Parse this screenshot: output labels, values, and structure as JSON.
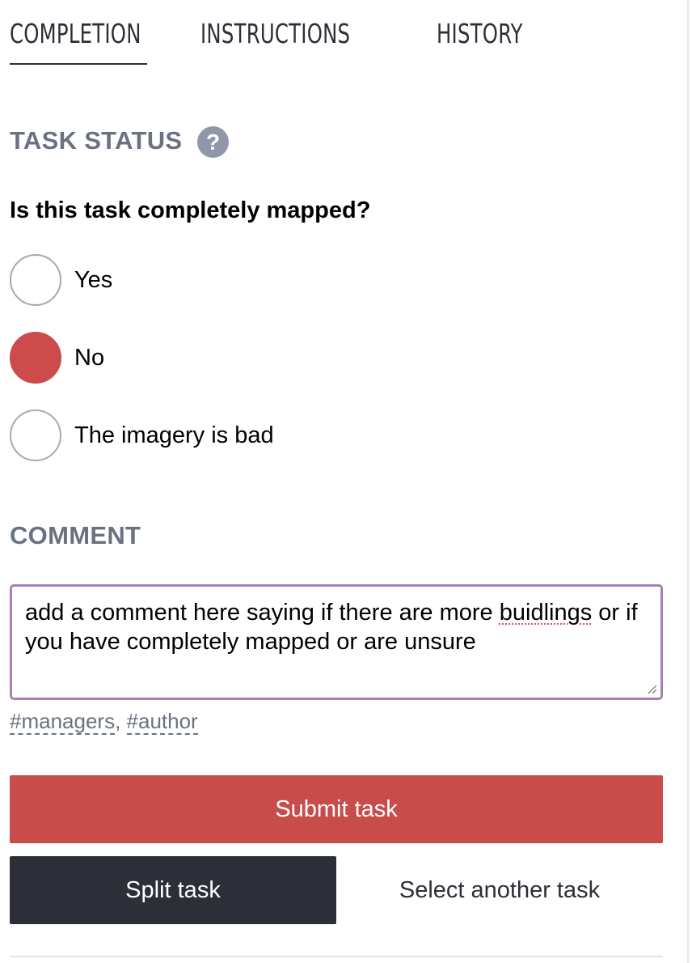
{
  "tabs": [
    {
      "label": "COMPLETION",
      "active": true
    },
    {
      "label": "INSTRUCTIONS",
      "active": false
    },
    {
      "label": "HISTORY",
      "active": false
    }
  ],
  "task_status": {
    "title": "TASK STATUS",
    "help_icon": "question-circle-icon",
    "question": "Is this task completely mapped?",
    "options": [
      {
        "label": "Yes",
        "selected": false
      },
      {
        "label": "No",
        "selected": true
      },
      {
        "label": "The imagery is bad",
        "selected": false
      }
    ]
  },
  "comment": {
    "title": "COMMENT",
    "text_before": "add a comment here saying if there are more ",
    "misspelled_word": "buidlings",
    "text_after": " or if you have completely mapped or are unsure",
    "mentions": [
      "#managers",
      "#author"
    ],
    "mention_separator": ", "
  },
  "actions": {
    "submit_label": "Submit task",
    "split_label": "Split task",
    "select_another_label": "Select another task"
  },
  "colors": {
    "accent_red": "#c84c49",
    "dark": "#2c2f38",
    "muted_gray": "#6a7281",
    "focus_border": "#a97fb3"
  }
}
